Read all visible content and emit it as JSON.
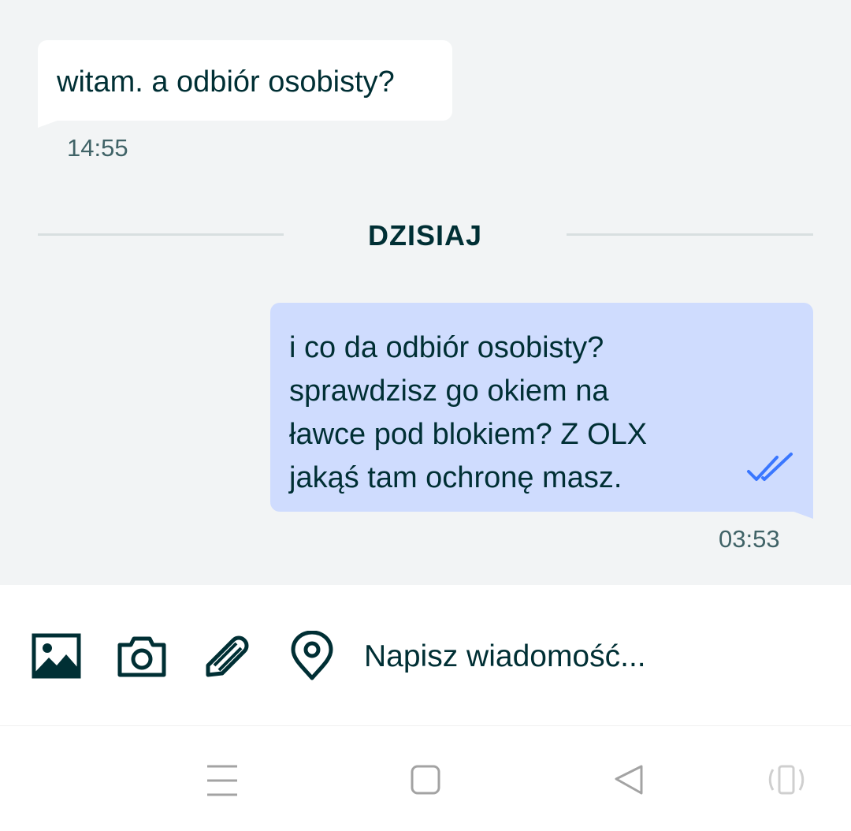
{
  "conversation": {
    "incoming_message": {
      "text": "witam. a odbiór osobisty?",
      "time": "14:55"
    },
    "day_divider": "DZISIAJ",
    "outgoing_message": {
      "lines": [
        "i co da odbiór osobisty?",
        "sprawdzisz go okiem na",
        "ławce pod blokiem? Z OLX",
        "jakąś tam ochronę masz."
      ],
      "time": "03:53",
      "status_icon": "double-check-icon"
    }
  },
  "composer": {
    "placeholder": "Napisz wiadomość...",
    "icons": [
      "image-icon",
      "camera-icon",
      "paperclip-icon",
      "location-pin-icon"
    ]
  },
  "system_nav": {
    "icons": [
      "menu-icon",
      "home-icon",
      "back-icon",
      "rotate-icon"
    ]
  },
  "colors": {
    "background": "#f2f4f5",
    "incoming_bubble": "#ffffff",
    "outgoing_bubble": "#cfdcfe",
    "text": "#002f34",
    "read_check": "#3a77ff"
  }
}
